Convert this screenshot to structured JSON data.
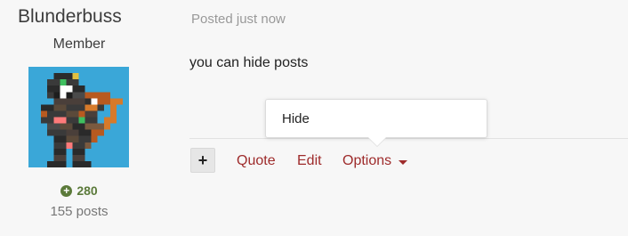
{
  "author": {
    "name": "Blunderbuss",
    "role": "Member",
    "reputation": "280",
    "post_count": "155 posts"
  },
  "post": {
    "date": "Posted just now",
    "body": "you can hide posts"
  },
  "actions": {
    "plus_label": "+",
    "quote_label": "Quote",
    "edit_label": "Edit",
    "options_label": "Options"
  },
  "options_menu": {
    "items": [
      "Hide"
    ]
  },
  "colors": {
    "link": "#9e2b2b",
    "reputation": "#5b7a3a",
    "avatar_bg": "#3aa7d8"
  },
  "icons": {
    "reputation": "plus-circle-icon",
    "options_caret": "caret-down-icon"
  }
}
